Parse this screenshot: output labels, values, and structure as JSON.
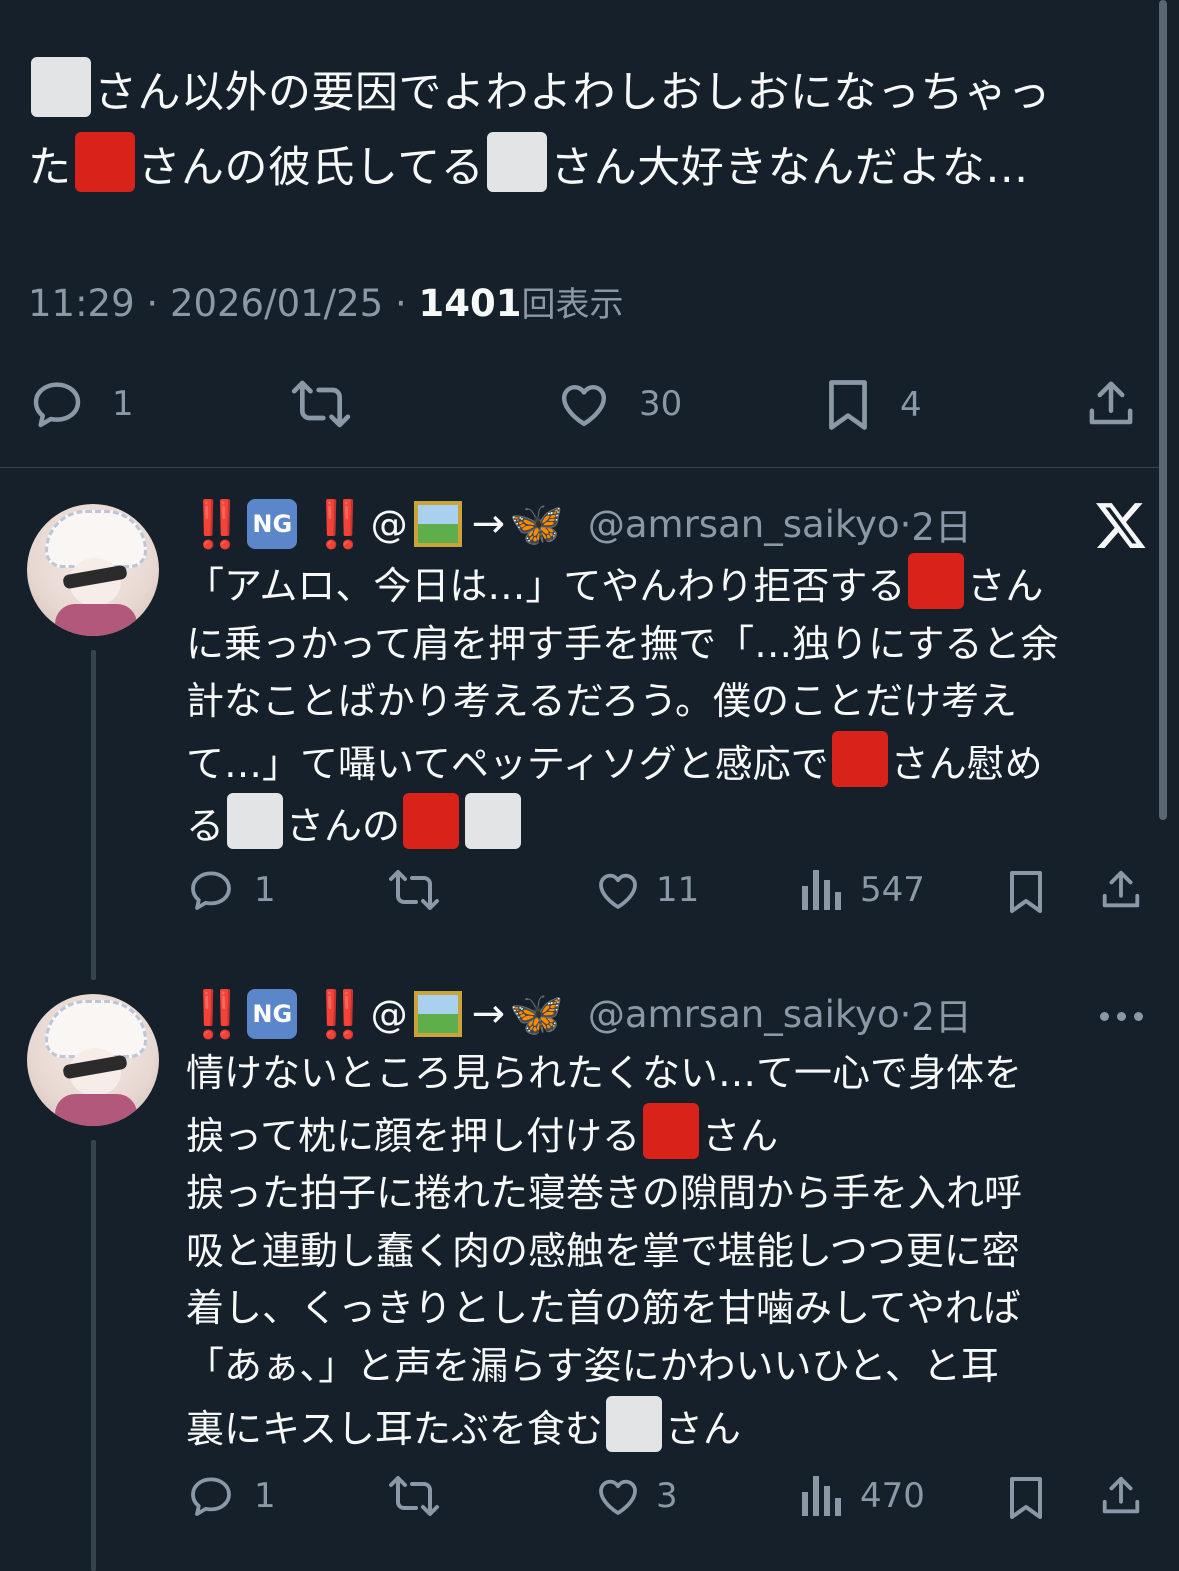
{
  "main_tweet": {
    "line1_text": "さん以外の要因でよわよわしおしおになっちゃっ",
    "line2_a": "た",
    "line2_b": "さんの彼氏してる",
    "line2_c": "さん大好きなんだよな…",
    "time": "11:29",
    "date": "2026/01/25",
    "views_count": "1401",
    "views_label": "回表示",
    "sep": " · ",
    "replies": "1",
    "likes": "30",
    "bookmarks": "4"
  },
  "replies": [
    {
      "bang": "‼️",
      "ng": "NG",
      "at": "@",
      "arrow": "→",
      "butterfly": "🦋",
      "handle": "@amrsan_saikyo",
      "time_sep": " · ",
      "time": "2日",
      "segments": [
        {
          "t": "「アムロ、今日は…」てやんわり拒否する"
        },
        {
          "sq": "red"
        },
        {
          "t": "さん\nに乗っかって肩を押す手を撫で「…独りにすると余\n計なことばかり考えるだろう。僕のことだけ考え\nて…」て囁いてペッティソグと感応で"
        },
        {
          "sq": "red"
        },
        {
          "t": "さん慰め\nる"
        },
        {
          "sq": "white"
        },
        {
          "t": "さんの"
        },
        {
          "sq": "red"
        },
        {
          "sq": "white"
        }
      ],
      "replies": "1",
      "likes": "11",
      "views": "547"
    },
    {
      "bang": "‼️",
      "ng": "NG",
      "at": "@",
      "arrow": "→",
      "butterfly": "🦋",
      "handle": "@amrsan_saikyo",
      "time_sep": " · ",
      "time": "2日",
      "segments": [
        {
          "t": "情けないところ見られたくない…て一心で身体を\n捩って枕に顔を押し付ける"
        },
        {
          "sq": "red"
        },
        {
          "t": "さん\n捩った拍子に捲れた寝巻きの隙間から手を入れ呼\n吸と連動し蠢く肉の感触を掌で堪能しつつ更に密\n着し、くっきりとした首の筋を甘噛みしてやれば\n「あぁ、」と声を漏らす姿にかわいいひと、と耳\n裏にキスし耳たぶを食む"
        },
        {
          "sq": "white"
        },
        {
          "t": "さん"
        }
      ],
      "replies": "1",
      "likes": "3",
      "views": "470"
    }
  ],
  "colors": {
    "background": "#15202b",
    "text": "#f7f9f9",
    "secondary": "#8b98a5",
    "square_red": "#d9231a",
    "square_white": "#e3e4e6"
  }
}
